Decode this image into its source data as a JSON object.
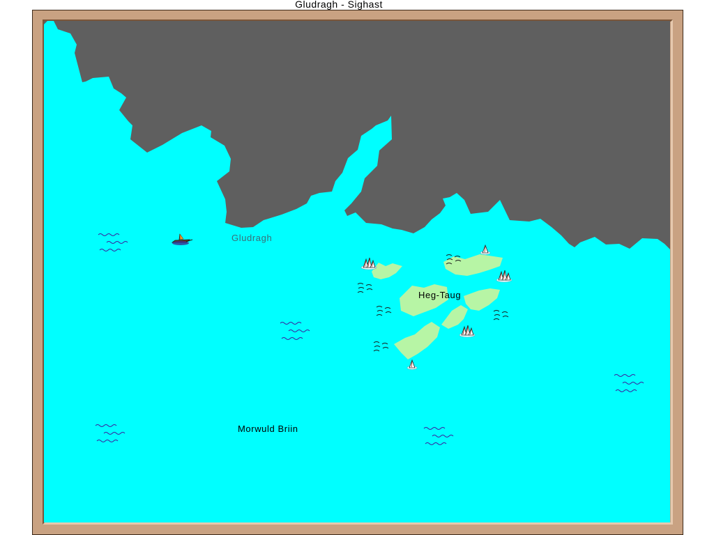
{
  "window": {
    "title": "Gludragh - Sighast"
  },
  "colors": {
    "sea": "#00ffff",
    "land": "#5f5f5f",
    "islands": "#b7f5a5",
    "frame": "#c9a282",
    "wave": "#3b1f9e"
  },
  "map": {
    "labels": {
      "town": "Gludragh",
      "island_group": "Heg-Taug",
      "sea": "Morwuld Briin"
    },
    "icons": [
      "player-boat-icon",
      "sea-wave-icon",
      "reef-icon",
      "rock-spire-icon"
    ]
  }
}
